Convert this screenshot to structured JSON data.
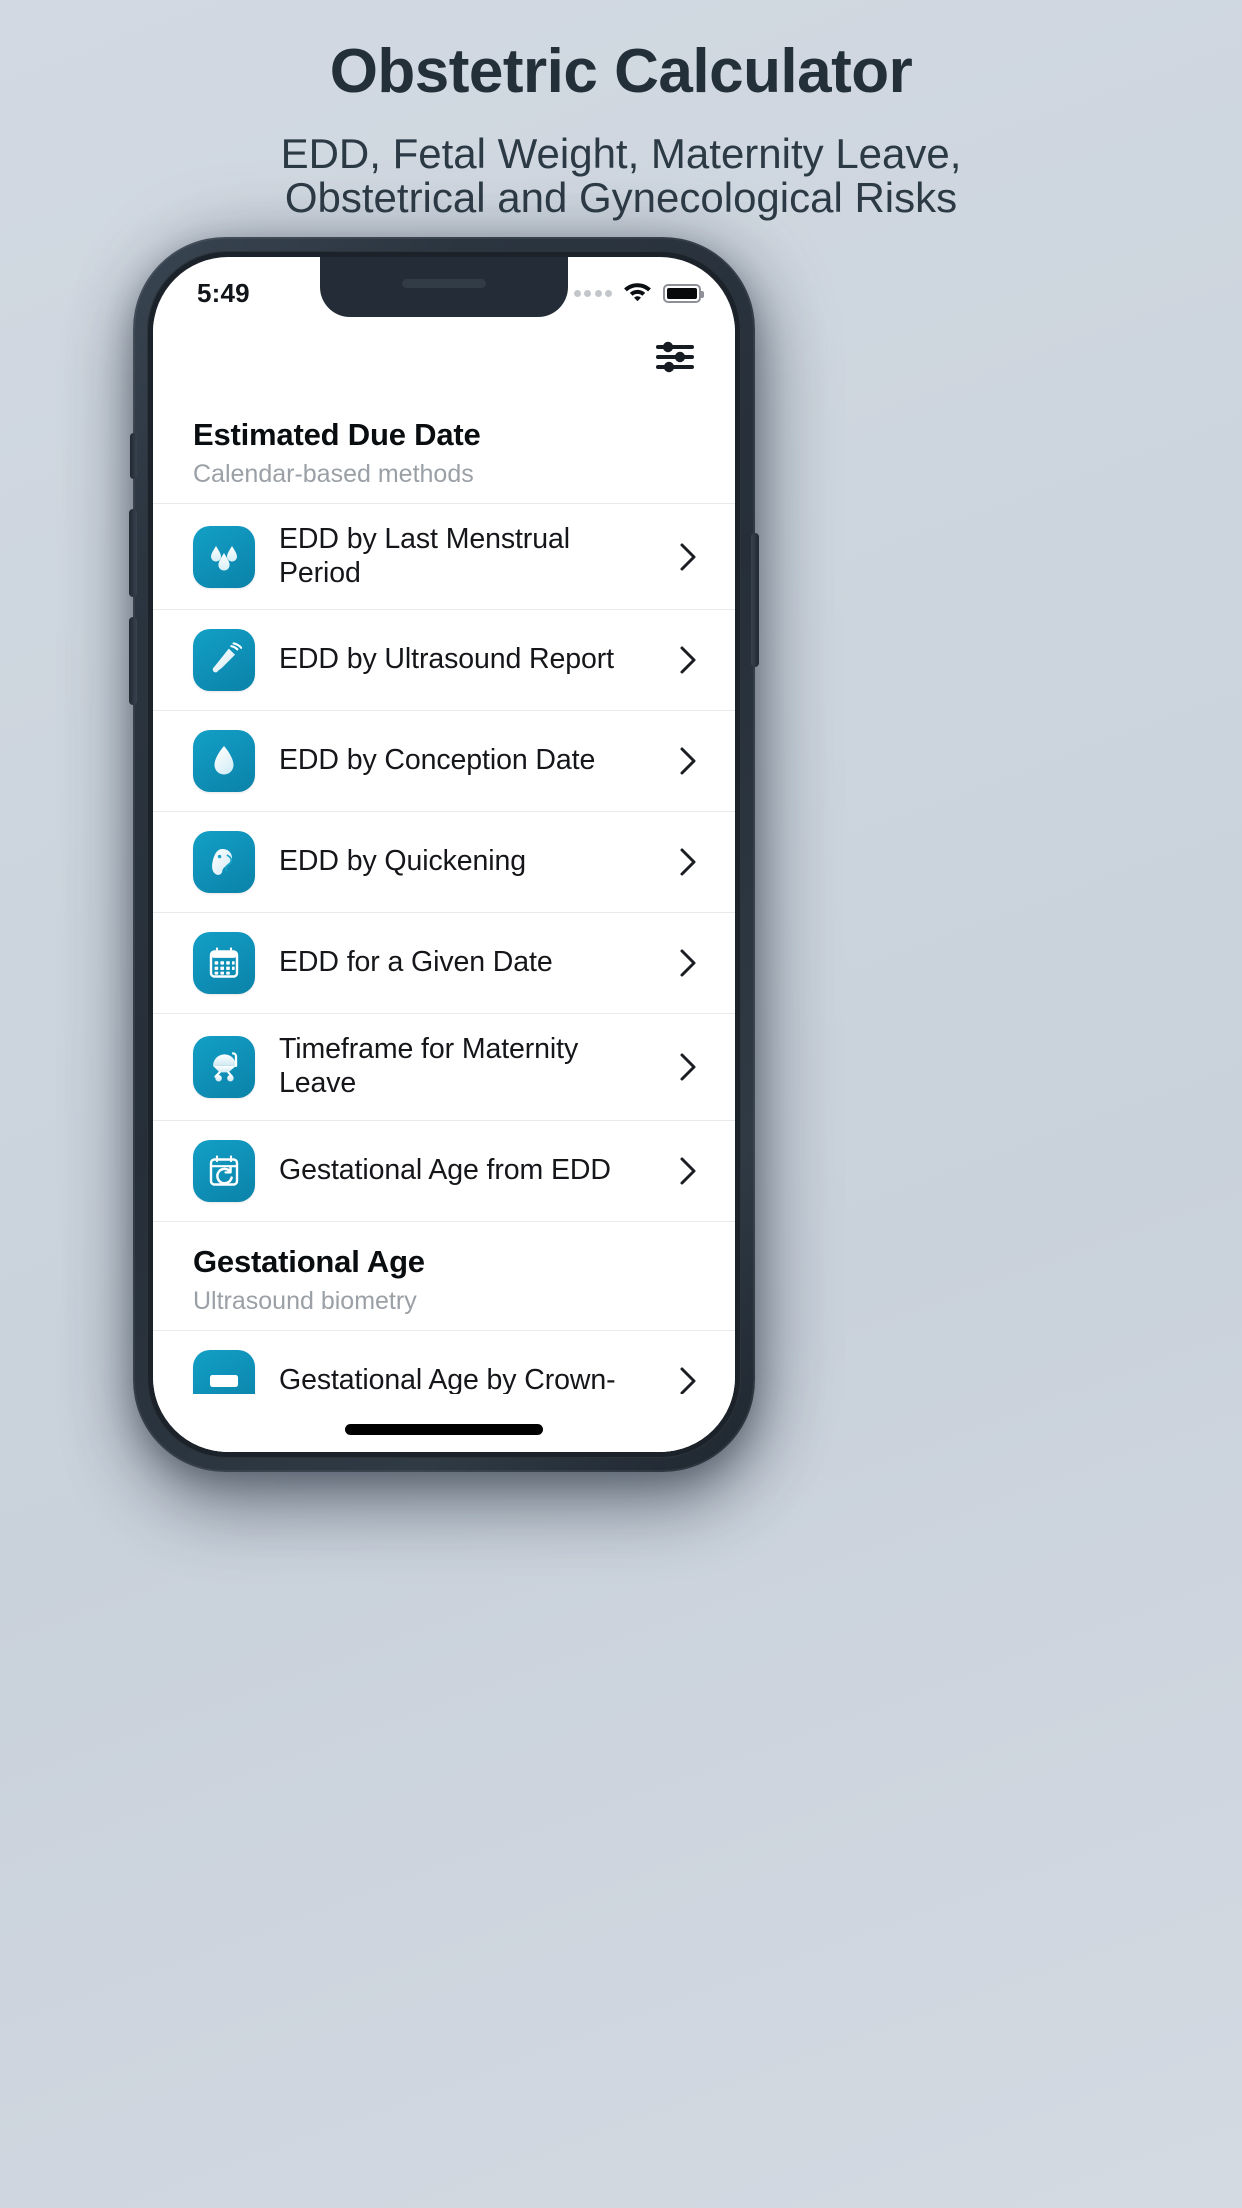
{
  "promo": {
    "title": "Obstetric Calculator",
    "subtitle_line1": "EDD, Fetal Weight, Maternity Leave,",
    "subtitle_line2": "Obstetrical and Gynecological Risks"
  },
  "theme": {
    "accent": "#0f92b9",
    "page_bg": "#ced5de",
    "heading_color": "#232f39",
    "screen_bg": "#ffffff",
    "muted_text": "#9aa0a6",
    "divider": "#e9eaec",
    "device_body": "#2b3540"
  },
  "status_bar": {
    "time": "5:49",
    "signal_icon": "signal-dots-icon",
    "wifi_icon": "wifi-icon",
    "battery_icon": "battery-full-icon"
  },
  "appbar": {
    "settings_icon": "sliders-icon"
  },
  "sections": [
    {
      "title": "Estimated Due Date",
      "subtitle": "Calendar-based methods",
      "items": [
        {
          "label": "EDD by Last Menstrual Period",
          "icon": "blood-drops-icon",
          "chevron": "chevron-right-icon"
        },
        {
          "label": "EDD by Ultrasound Report",
          "icon": "ultrasound-probe-icon",
          "chevron": "chevron-right-icon"
        },
        {
          "label": "EDD by Conception Date",
          "icon": "ovum-egg-icon",
          "chevron": "chevron-right-icon"
        },
        {
          "label": "EDD by Quickening",
          "icon": "fetus-icon",
          "chevron": "chevron-right-icon"
        },
        {
          "label": "EDD for a Given Date",
          "icon": "calendar-icon",
          "chevron": "chevron-right-icon"
        },
        {
          "label": "Timeframe for Maternity Leave",
          "icon": "stroller-icon",
          "chevron": "chevron-right-icon"
        },
        {
          "label": "Gestational Age from EDD",
          "icon": "calendar-refresh-icon",
          "chevron": "chevron-right-icon"
        }
      ]
    },
    {
      "title": "Gestational Age",
      "subtitle": "Ultrasound biometry",
      "items": [
        {
          "label": "Gestational Age by Crown-",
          "icon": "ruler-icon",
          "chevron": "chevron-right-icon"
        }
      ]
    }
  ]
}
